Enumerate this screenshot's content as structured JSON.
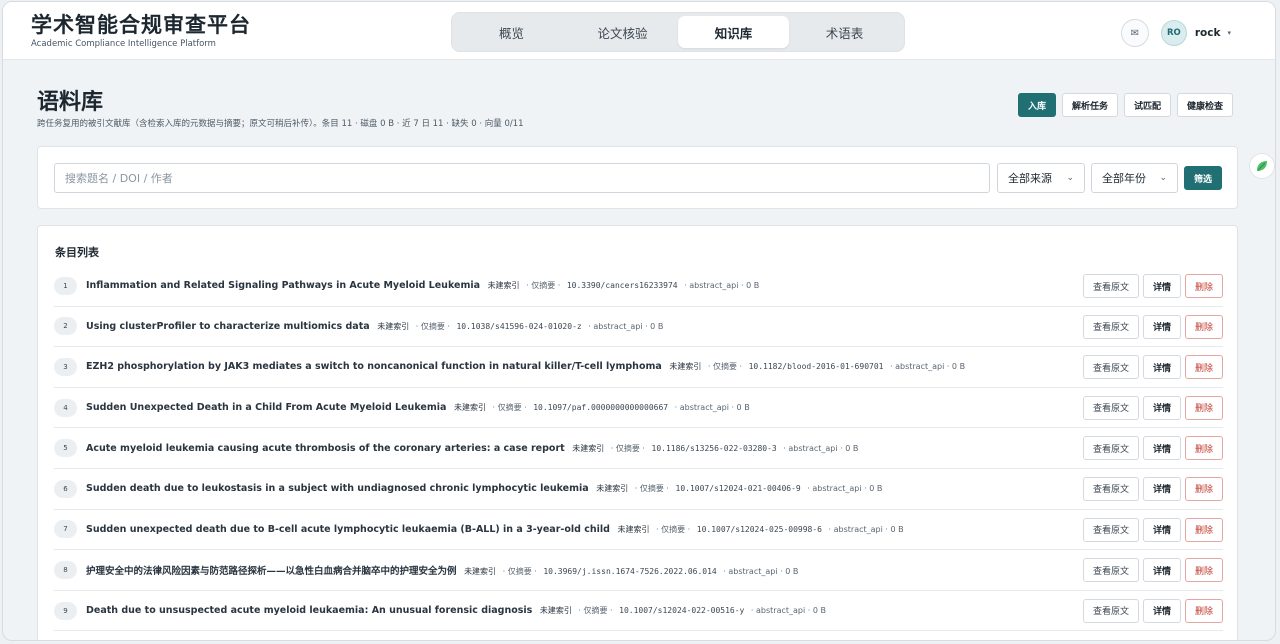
{
  "app": {
    "title": "学术智能合规审查平台",
    "subtitle": "Academic Compliance Intelligence Platform"
  },
  "nav": {
    "tabs": [
      {
        "label": "概览"
      },
      {
        "label": "论文核验"
      },
      {
        "label": "知识库",
        "active": true
      },
      {
        "label": "术语表"
      }
    ]
  },
  "user": {
    "mail_icon": "✉",
    "avatar": "RO",
    "name": "rock",
    "caret": "▾"
  },
  "page": {
    "title": "语料库",
    "description": "跨任务复用的被引文献库（含检索入库的元数据与摘要；原文可稍后补传）。条目 11 · 磁盘 0 B · 近 7 日 11 · 缺失 0 · 向量 0/11",
    "actions": {
      "ingest": "入库",
      "parse_tasks": "解析任务",
      "trial_match": "试匹配",
      "health_check": "健康检查"
    }
  },
  "filters": {
    "search_placeholder": "搜索题名 / DOI / 作者",
    "source": "全部来源",
    "year": "全部年份",
    "filter_button": "筛选",
    "chevron": "⌄"
  },
  "list": {
    "title": "条目列表",
    "view_label": "查看原文",
    "detail_label": "详情",
    "delete_label": "删除",
    "items": [
      {
        "idx": "1",
        "title": "Inflammation and Related Signaling Pathways in Acute Myeloid Leukemia",
        "status": "未建索引",
        "kind": "· 仅摘要 ·",
        "doi": "10.3390/cancers16233974",
        "meta": "· abstract_api · 0 B"
      },
      {
        "idx": "2",
        "title": "Using clusterProfiler to characterize multiomics data",
        "status": "未建索引",
        "kind": "· 仅摘要 ·",
        "doi": "10.1038/s41596-024-01020-z",
        "meta": "· abstract_api · 0 B"
      },
      {
        "idx": "3",
        "title": "EZH2 phosphorylation by JAK3 mediates a switch to noncanonical function in natural killer/T-cell lymphoma",
        "status": "未建索引",
        "kind": "· 仅摘要 ·",
        "doi": "10.1182/blood-2016-01-690701",
        "meta": "· abstract_api · 0 B"
      },
      {
        "idx": "4",
        "title": "Sudden Unexpected Death in a Child From Acute Myeloid Leukemia",
        "status": "未建索引",
        "kind": "· 仅摘要 ·",
        "doi": "10.1097/paf.0000000000000667",
        "meta": "· abstract_api · 0 B"
      },
      {
        "idx": "5",
        "title": "Acute myeloid leukemia causing acute thrombosis of the coronary arteries: a case report",
        "status": "未建索引",
        "kind": "· 仅摘要 ·",
        "doi": "10.1186/s13256-022-03280-3",
        "meta": "· abstract_api · 0 B"
      },
      {
        "idx": "6",
        "title": "Sudden death due to leukostasis in a subject with undiagnosed chronic lymphocytic leukemia",
        "status": "未建索引",
        "kind": "· 仅摘要 ·",
        "doi": "10.1007/s12024-021-00406-9",
        "meta": "· abstract_api · 0 B"
      },
      {
        "idx": "7",
        "title": "Sudden unexpected death due to B-cell acute lymphocytic leukaemia (B-ALL) in a 3-year-old child",
        "status": "未建索引",
        "kind": "· 仅摘要 ·",
        "doi": "10.1007/s12024-025-00998-6",
        "meta": "· abstract_api · 0 B"
      },
      {
        "idx": "8",
        "title": "护理安全中的法律风险因素与防范路径探析——以急性白血病合并脑卒中的护理安全为例",
        "status": "未建索引",
        "kind": "· 仅摘要 ·",
        "doi": "10.3969/j.issn.1674-7526.2022.06.014",
        "meta": "· abstract_api · 0 B"
      },
      {
        "idx": "9",
        "title": "Death due to unsuspected acute myeloid leukaemia: An unusual forensic diagnosis",
        "status": "未建索引",
        "kind": "· 仅摘要 ·",
        "doi": "10.1007/s12024-022-00516-y",
        "meta": "· abstract_api · 0 B"
      }
    ]
  }
}
